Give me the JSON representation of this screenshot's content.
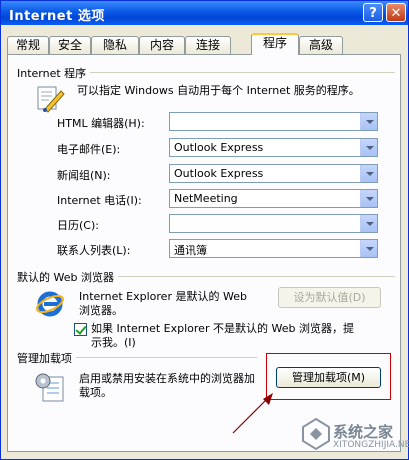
{
  "window": {
    "title": "Internet 选项"
  },
  "titlebar": {
    "help_label": "?",
    "close_label": "✕"
  },
  "tabs": [
    {
      "label": "常规"
    },
    {
      "label": "安全"
    },
    {
      "label": "隐私"
    },
    {
      "label": "内容"
    },
    {
      "label": "连接"
    },
    {
      "label": "程序",
      "active": true
    },
    {
      "label": "高级"
    }
  ],
  "programs": {
    "group_title": "Internet 程序",
    "description": "可以指定 Windows 自动用于每个 Internet 服务的程序。",
    "rows": [
      {
        "label": "HTML 编辑器(H):",
        "value": ""
      },
      {
        "label": "电子邮件(E):",
        "value": "Outlook Express"
      },
      {
        "label": "新闻组(N):",
        "value": "Outlook Express"
      },
      {
        "label": "Internet 电话(I):",
        "value": "NetMeeting"
      },
      {
        "label": "日历(C):",
        "value": ""
      },
      {
        "label": "联系人列表(L):",
        "value": "通讯簿"
      }
    ]
  },
  "default_browser": {
    "group_title": "默认的 Web 浏览器",
    "line1": "Internet Explorer 是默认的 Web",
    "line2": "浏览器。",
    "set_default_label": "设为默认值(D)",
    "check_line1": "如果 Internet Explorer 不是默认的 Web 浏览器，提",
    "check_line2": "示我。(I)",
    "checked": true
  },
  "addons": {
    "group_title": "管理加载项",
    "line1": "启用或禁用安装在系统中的浏览器加",
    "line2": "载项。",
    "manage_label": "管理加载项(M)"
  },
  "watermark": {
    "text": "系统之家",
    "sub": "XITONGZHIJIA.NET"
  },
  "colors": {
    "title_bar": "#0a58e6",
    "highlight_box": "#cc0000",
    "panel_bg": "#fcfcfe",
    "window_bg": "#ece9d8"
  }
}
